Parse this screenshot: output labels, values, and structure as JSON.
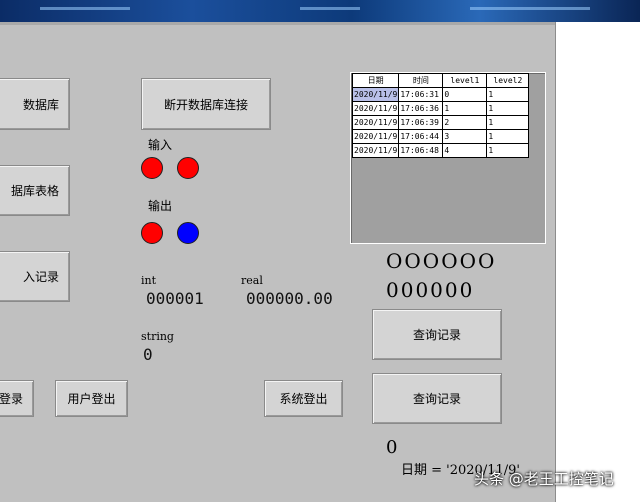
{
  "buttons": {
    "db_partial": "数据库",
    "disconnect": "断开数据库连接",
    "table_partial": "据库表格",
    "record_partial": "入记录",
    "login_partial": "登录",
    "user_logout": "用户登出",
    "system_logout": "系统登出",
    "query1": "查询记录",
    "query2": "查询记录"
  },
  "io": {
    "input_label": "输入",
    "output_label": "输出"
  },
  "indicators": {
    "input": [
      "#ff0000",
      "#ff0000"
    ],
    "output": [
      "#ff0000",
      "#0000ff"
    ]
  },
  "fields": {
    "int_label": "int",
    "int_value": "000001",
    "real_label": "real",
    "real_value": "000000.00",
    "string_label": "string",
    "string_value": "0"
  },
  "display": {
    "line1": "OOOOOO",
    "line2": "000000",
    "zero": "0",
    "date_query": "日期 = '2020/11/9'"
  },
  "table": {
    "headers": [
      "日期",
      "时间",
      "level1",
      "level2"
    ],
    "rows": [
      [
        "2020/11/9",
        "17:06:31",
        "0",
        "1"
      ],
      [
        "2020/11/9",
        "17:06:36",
        "1",
        "1"
      ],
      [
        "2020/11/9",
        "17:06:39",
        "2",
        "1"
      ],
      [
        "2020/11/9",
        "17:06:44",
        "3",
        "1"
      ],
      [
        "2020/11/9",
        "17:06:48",
        "4",
        "1"
      ]
    ]
  },
  "watermark": "头条 @老王工控笔记"
}
